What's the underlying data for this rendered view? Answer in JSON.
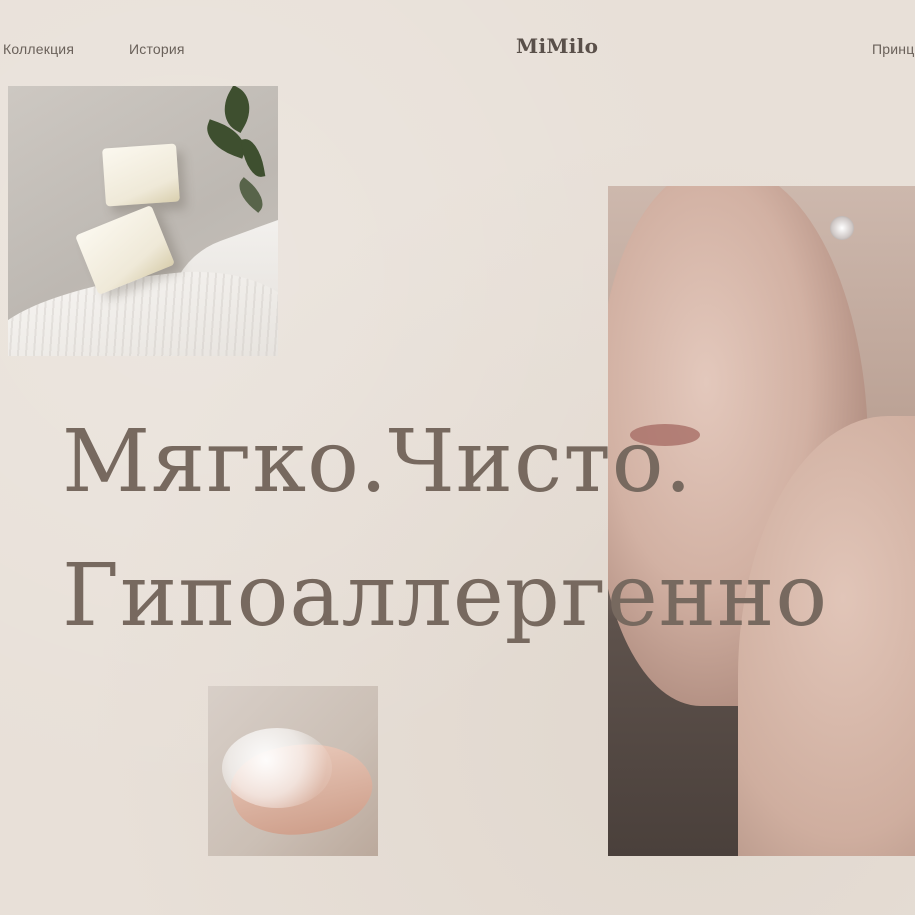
{
  "nav": {
    "left_links": [
      "Коллекция",
      "История"
    ],
    "right_link": "Принц"
  },
  "brand": {
    "logo": "MiMilo"
  },
  "hero": {
    "line1": "Мягко.Чисто.",
    "line2": "Гипоаллергенно"
  },
  "images": {
    "soap": "soap-bars-photo",
    "portrait": "portrait-photo",
    "hand": "hand-foam-photo"
  },
  "colors": {
    "background": "#e8e0d8",
    "text": "#77695f",
    "nav_text": "#6a615a"
  }
}
